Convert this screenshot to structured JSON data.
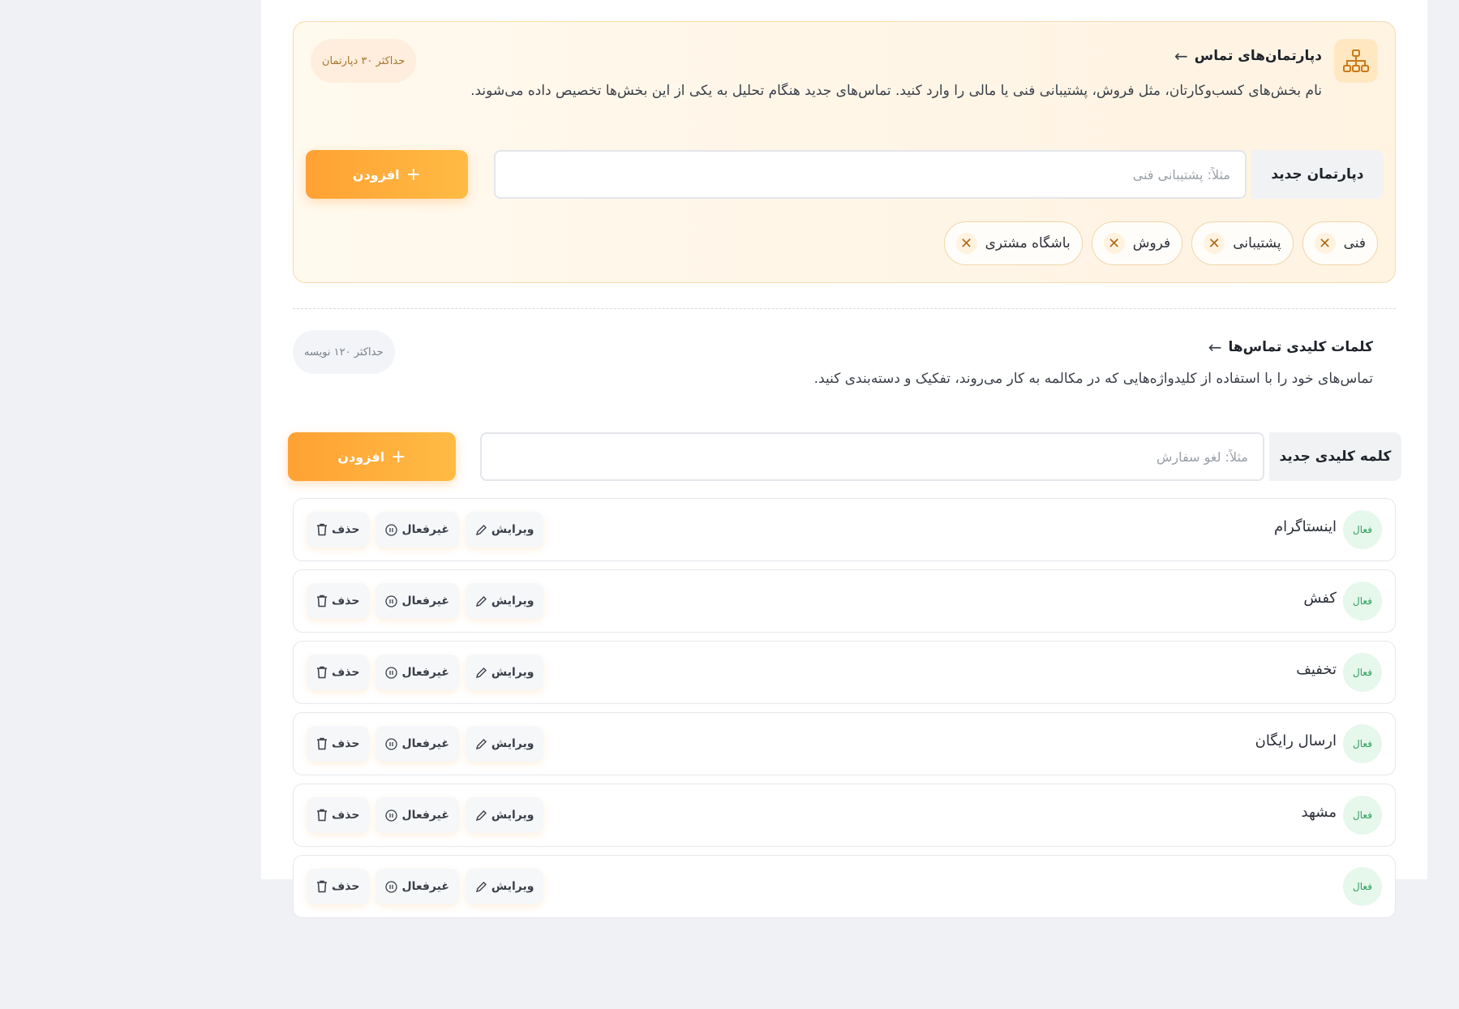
{
  "departments": {
    "title": "دپارتمان‌های تماس",
    "description": "نام بخش‌های کسب‌وکارتان، مثل فروش، پشتیبانی فنی یا مالی را وارد کنید. تماس‌های جدید هنگام تحلیل به یکی از این بخش‌ها تخصیص داده می‌شوند.",
    "limit": "حداکثر ۳۰ دپارتمان",
    "input_label": "دپارتمان جدید",
    "input_placeholder": "مثلاً: پشتیبانی فنی",
    "add_label": "افزودن",
    "chips": [
      {
        "label": "فنی"
      },
      {
        "label": "پشتیبانی"
      },
      {
        "label": "فروش"
      },
      {
        "label": "باشگاه مشتری"
      }
    ]
  },
  "keywords": {
    "title": "کلمات کلیدی تماس‌ها",
    "description": "تماس‌های خود را با استفاده از کلیدواژه‌هایی که در مکالمه به کار می‌روند، تفکیک و دسته‌بندی کنید.",
    "limit": "حداکثر ۱۲۰ نویسه",
    "input_label": "کلمه کلیدی جدید",
    "input_placeholder": "مثلاً: لغو سفارش",
    "add_label": "افزودن",
    "status_label": "فعال",
    "edit_label": "ویرایش",
    "deactivate_label": "غیرفعال",
    "delete_label": "حذف",
    "items": [
      {
        "label": "اینستاگرام"
      },
      {
        "label": "کفش"
      },
      {
        "label": "تخفیف"
      },
      {
        "label": "ارسال رایگان"
      },
      {
        "label": "مشهد"
      },
      {
        "label": ""
      }
    ]
  },
  "colors": {
    "accent": "#ffa133",
    "active_green": "#2e9e5b",
    "dept_border": "#f7dcb0"
  }
}
